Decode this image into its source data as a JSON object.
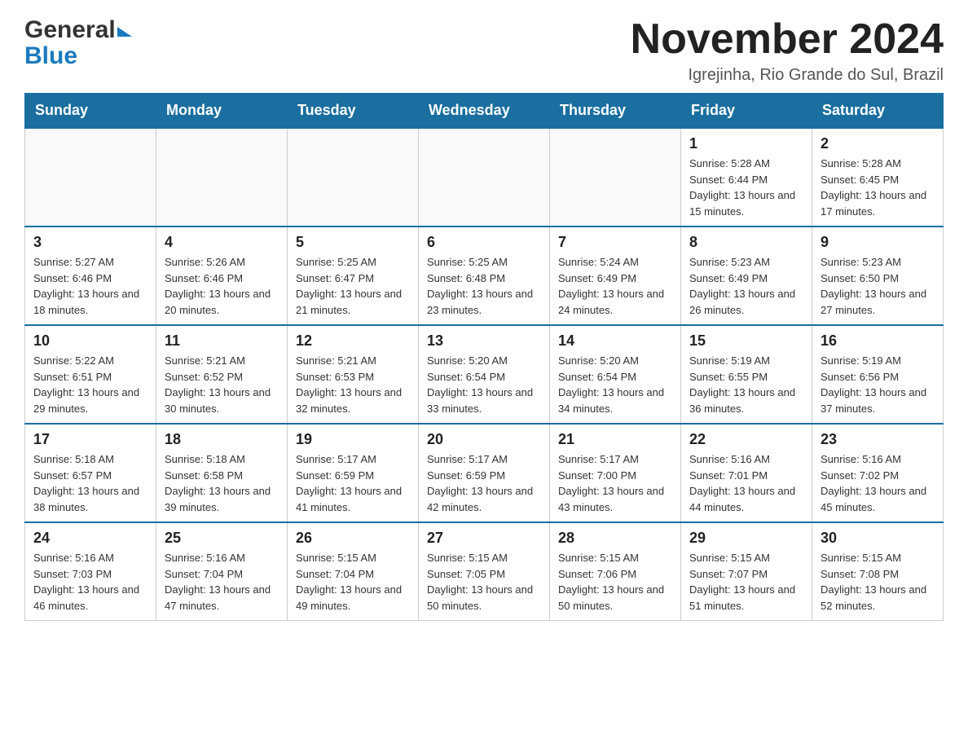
{
  "header": {
    "logo": {
      "general": "General",
      "blue": "Blue"
    },
    "title": "November 2024",
    "subtitle": "Igrejinha, Rio Grande do Sul, Brazil"
  },
  "weekdays": [
    "Sunday",
    "Monday",
    "Tuesday",
    "Wednesday",
    "Thursday",
    "Friday",
    "Saturday"
  ],
  "weeks": [
    [
      {
        "day": "",
        "info": ""
      },
      {
        "day": "",
        "info": ""
      },
      {
        "day": "",
        "info": ""
      },
      {
        "day": "",
        "info": ""
      },
      {
        "day": "",
        "info": ""
      },
      {
        "day": "1",
        "info": "Sunrise: 5:28 AM\nSunset: 6:44 PM\nDaylight: 13 hours and 15 minutes."
      },
      {
        "day": "2",
        "info": "Sunrise: 5:28 AM\nSunset: 6:45 PM\nDaylight: 13 hours and 17 minutes."
      }
    ],
    [
      {
        "day": "3",
        "info": "Sunrise: 5:27 AM\nSunset: 6:46 PM\nDaylight: 13 hours and 18 minutes."
      },
      {
        "day": "4",
        "info": "Sunrise: 5:26 AM\nSunset: 6:46 PM\nDaylight: 13 hours and 20 minutes."
      },
      {
        "day": "5",
        "info": "Sunrise: 5:25 AM\nSunset: 6:47 PM\nDaylight: 13 hours and 21 minutes."
      },
      {
        "day": "6",
        "info": "Sunrise: 5:25 AM\nSunset: 6:48 PM\nDaylight: 13 hours and 23 minutes."
      },
      {
        "day": "7",
        "info": "Sunrise: 5:24 AM\nSunset: 6:49 PM\nDaylight: 13 hours and 24 minutes."
      },
      {
        "day": "8",
        "info": "Sunrise: 5:23 AM\nSunset: 6:49 PM\nDaylight: 13 hours and 26 minutes."
      },
      {
        "day": "9",
        "info": "Sunrise: 5:23 AM\nSunset: 6:50 PM\nDaylight: 13 hours and 27 minutes."
      }
    ],
    [
      {
        "day": "10",
        "info": "Sunrise: 5:22 AM\nSunset: 6:51 PM\nDaylight: 13 hours and 29 minutes."
      },
      {
        "day": "11",
        "info": "Sunrise: 5:21 AM\nSunset: 6:52 PM\nDaylight: 13 hours and 30 minutes."
      },
      {
        "day": "12",
        "info": "Sunrise: 5:21 AM\nSunset: 6:53 PM\nDaylight: 13 hours and 32 minutes."
      },
      {
        "day": "13",
        "info": "Sunrise: 5:20 AM\nSunset: 6:54 PM\nDaylight: 13 hours and 33 minutes."
      },
      {
        "day": "14",
        "info": "Sunrise: 5:20 AM\nSunset: 6:54 PM\nDaylight: 13 hours and 34 minutes."
      },
      {
        "day": "15",
        "info": "Sunrise: 5:19 AM\nSunset: 6:55 PM\nDaylight: 13 hours and 36 minutes."
      },
      {
        "day": "16",
        "info": "Sunrise: 5:19 AM\nSunset: 6:56 PM\nDaylight: 13 hours and 37 minutes."
      }
    ],
    [
      {
        "day": "17",
        "info": "Sunrise: 5:18 AM\nSunset: 6:57 PM\nDaylight: 13 hours and 38 minutes."
      },
      {
        "day": "18",
        "info": "Sunrise: 5:18 AM\nSunset: 6:58 PM\nDaylight: 13 hours and 39 minutes."
      },
      {
        "day": "19",
        "info": "Sunrise: 5:17 AM\nSunset: 6:59 PM\nDaylight: 13 hours and 41 minutes."
      },
      {
        "day": "20",
        "info": "Sunrise: 5:17 AM\nSunset: 6:59 PM\nDaylight: 13 hours and 42 minutes."
      },
      {
        "day": "21",
        "info": "Sunrise: 5:17 AM\nSunset: 7:00 PM\nDaylight: 13 hours and 43 minutes."
      },
      {
        "day": "22",
        "info": "Sunrise: 5:16 AM\nSunset: 7:01 PM\nDaylight: 13 hours and 44 minutes."
      },
      {
        "day": "23",
        "info": "Sunrise: 5:16 AM\nSunset: 7:02 PM\nDaylight: 13 hours and 45 minutes."
      }
    ],
    [
      {
        "day": "24",
        "info": "Sunrise: 5:16 AM\nSunset: 7:03 PM\nDaylight: 13 hours and 46 minutes."
      },
      {
        "day": "25",
        "info": "Sunrise: 5:16 AM\nSunset: 7:04 PM\nDaylight: 13 hours and 47 minutes."
      },
      {
        "day": "26",
        "info": "Sunrise: 5:15 AM\nSunset: 7:04 PM\nDaylight: 13 hours and 49 minutes."
      },
      {
        "day": "27",
        "info": "Sunrise: 5:15 AM\nSunset: 7:05 PM\nDaylight: 13 hours and 50 minutes."
      },
      {
        "day": "28",
        "info": "Sunrise: 5:15 AM\nSunset: 7:06 PM\nDaylight: 13 hours and 50 minutes."
      },
      {
        "day": "29",
        "info": "Sunrise: 5:15 AM\nSunset: 7:07 PM\nDaylight: 13 hours and 51 minutes."
      },
      {
        "day": "30",
        "info": "Sunrise: 5:15 AM\nSunset: 7:08 PM\nDaylight: 13 hours and 52 minutes."
      }
    ]
  ]
}
